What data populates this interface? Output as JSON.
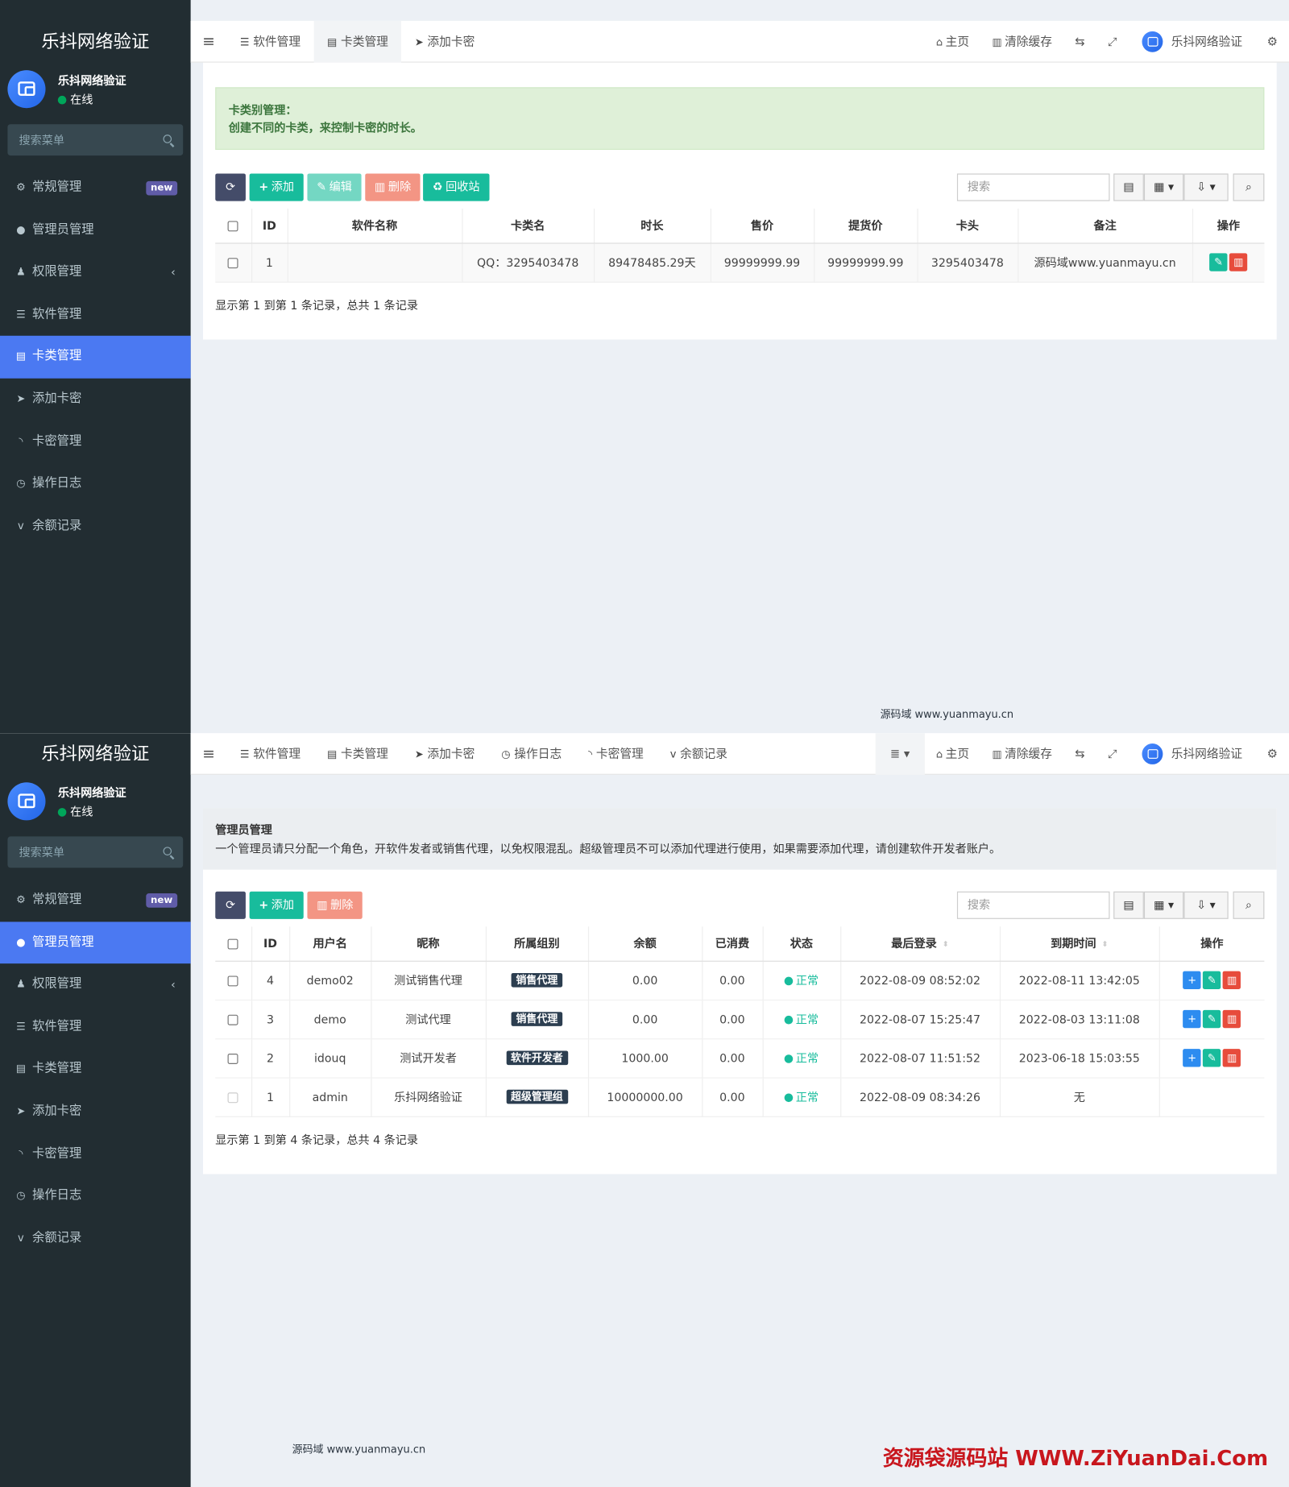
{
  "brand": "乐抖网络验证",
  "user": {
    "name": "乐抖网络验证",
    "status": "在线"
  },
  "sidebar_search_placeholder": "搜索菜单",
  "sidebar_items": [
    {
      "label": "常规管理",
      "icon": "cogs-icon",
      "badge": "new"
    },
    {
      "label": "管理员管理",
      "icon": "user-icon"
    },
    {
      "label": "权限管理",
      "icon": "group-icon",
      "chevron": "‹"
    },
    {
      "label": "软件管理",
      "icon": "list-icon"
    },
    {
      "label": "卡类管理",
      "icon": "tasks-icon"
    },
    {
      "label": "添加卡密",
      "icon": "send-icon"
    },
    {
      "label": "卡密管理",
      "icon": "rss-icon"
    },
    {
      "label": "操作日志",
      "icon": "clock-icon"
    },
    {
      "label": "余额记录",
      "icon": "vimeo-icon"
    }
  ],
  "top_right": {
    "home": "主页",
    "clear_cache": "清除缓存",
    "username": "乐抖网络验证"
  },
  "panel1": {
    "tabs": [
      "软件管理",
      "卡类管理",
      "添加卡密"
    ],
    "callout_title": "卡类别管理：",
    "callout_text": "创建不同的卡类，来控制卡密的时长。",
    "buttons": {
      "add": "添加",
      "edit": "编辑",
      "delete": "删除",
      "recycle": "回收站"
    },
    "search_placeholder": "搜索",
    "columns": [
      "ID",
      "软件名称",
      "卡类名",
      "时长",
      "售价",
      "提货价",
      "卡头",
      "备注",
      "操作"
    ],
    "rows": [
      {
        "id": "1",
        "software": "",
        "card_type": "QQ：3295403478",
        "duration": "89478485.29天",
        "price": "99999999.99",
        "pickup_price": "99999999.99",
        "prefix": "3295403478",
        "remark": "源码域www.yuanmayu.cn"
      }
    ],
    "page_info": "显示第 1 到第 1 条记录，总共 1 条记录",
    "watermark": "源码域 www.yuanmayu.cn"
  },
  "panel2": {
    "tabs": [
      "软件管理",
      "卡类管理",
      "添加卡密",
      "操作日志",
      "卡密管理",
      "余额记录"
    ],
    "info_title": "管理员管理",
    "info_text": "一个管理员请只分配一个角色，开软件发者或销售代理，以免权限混乱。超级管理员不可以添加代理进行使用，如果需要添加代理，请创建软件开发者账户。",
    "buttons": {
      "add": "添加",
      "delete": "删除"
    },
    "search_placeholder": "搜索",
    "columns": [
      "ID",
      "用户名",
      "昵称",
      "所属组别",
      "余额",
      "已消费",
      "状态",
      "最后登录",
      "到期时间",
      "操作"
    ],
    "rows": [
      {
        "id": "4",
        "username": "demo02",
        "nickname": "测试销售代理",
        "group": "销售代理",
        "balance": "0.00",
        "spent": "0.00",
        "status": "正常",
        "last_login": "2022-08-09 08:52:02",
        "expire": "2022-08-11 13:42:05",
        "actions": true
      },
      {
        "id": "3",
        "username": "demo",
        "nickname": "测试代理",
        "group": "销售代理",
        "balance": "0.00",
        "spent": "0.00",
        "status": "正常",
        "last_login": "2022-08-07 15:25:47",
        "expire": "2022-08-03 13:11:08",
        "actions": true
      },
      {
        "id": "2",
        "username": "idouq",
        "nickname": "测试开发者",
        "group": "软件开发者",
        "balance": "1000.00",
        "spent": "0.00",
        "status": "正常",
        "last_login": "2022-08-07 11:51:52",
        "expire": "2023-06-18 15:03:55",
        "actions": true
      },
      {
        "id": "1",
        "username": "admin",
        "nickname": "乐抖网络验证",
        "group": "超级管理组",
        "balance": "10000000.00",
        "spent": "0.00",
        "status": "正常",
        "last_login": "2022-08-09 08:34:26",
        "expire": "无",
        "actions": false
      }
    ],
    "page_info": "显示第 1 到第 4 条记录，总共 4 条记录",
    "watermark": "源码域 www.yuanmayu.cn"
  },
  "footer_mark": "资源袋源码站 WWW.ZiYuanDai.Com",
  "colors": {
    "sidebar": "#222d32",
    "active": "#4b79f2",
    "success": "#18bc9c",
    "danger": "#e74c3c",
    "callout_bg": "#dff0d8"
  }
}
